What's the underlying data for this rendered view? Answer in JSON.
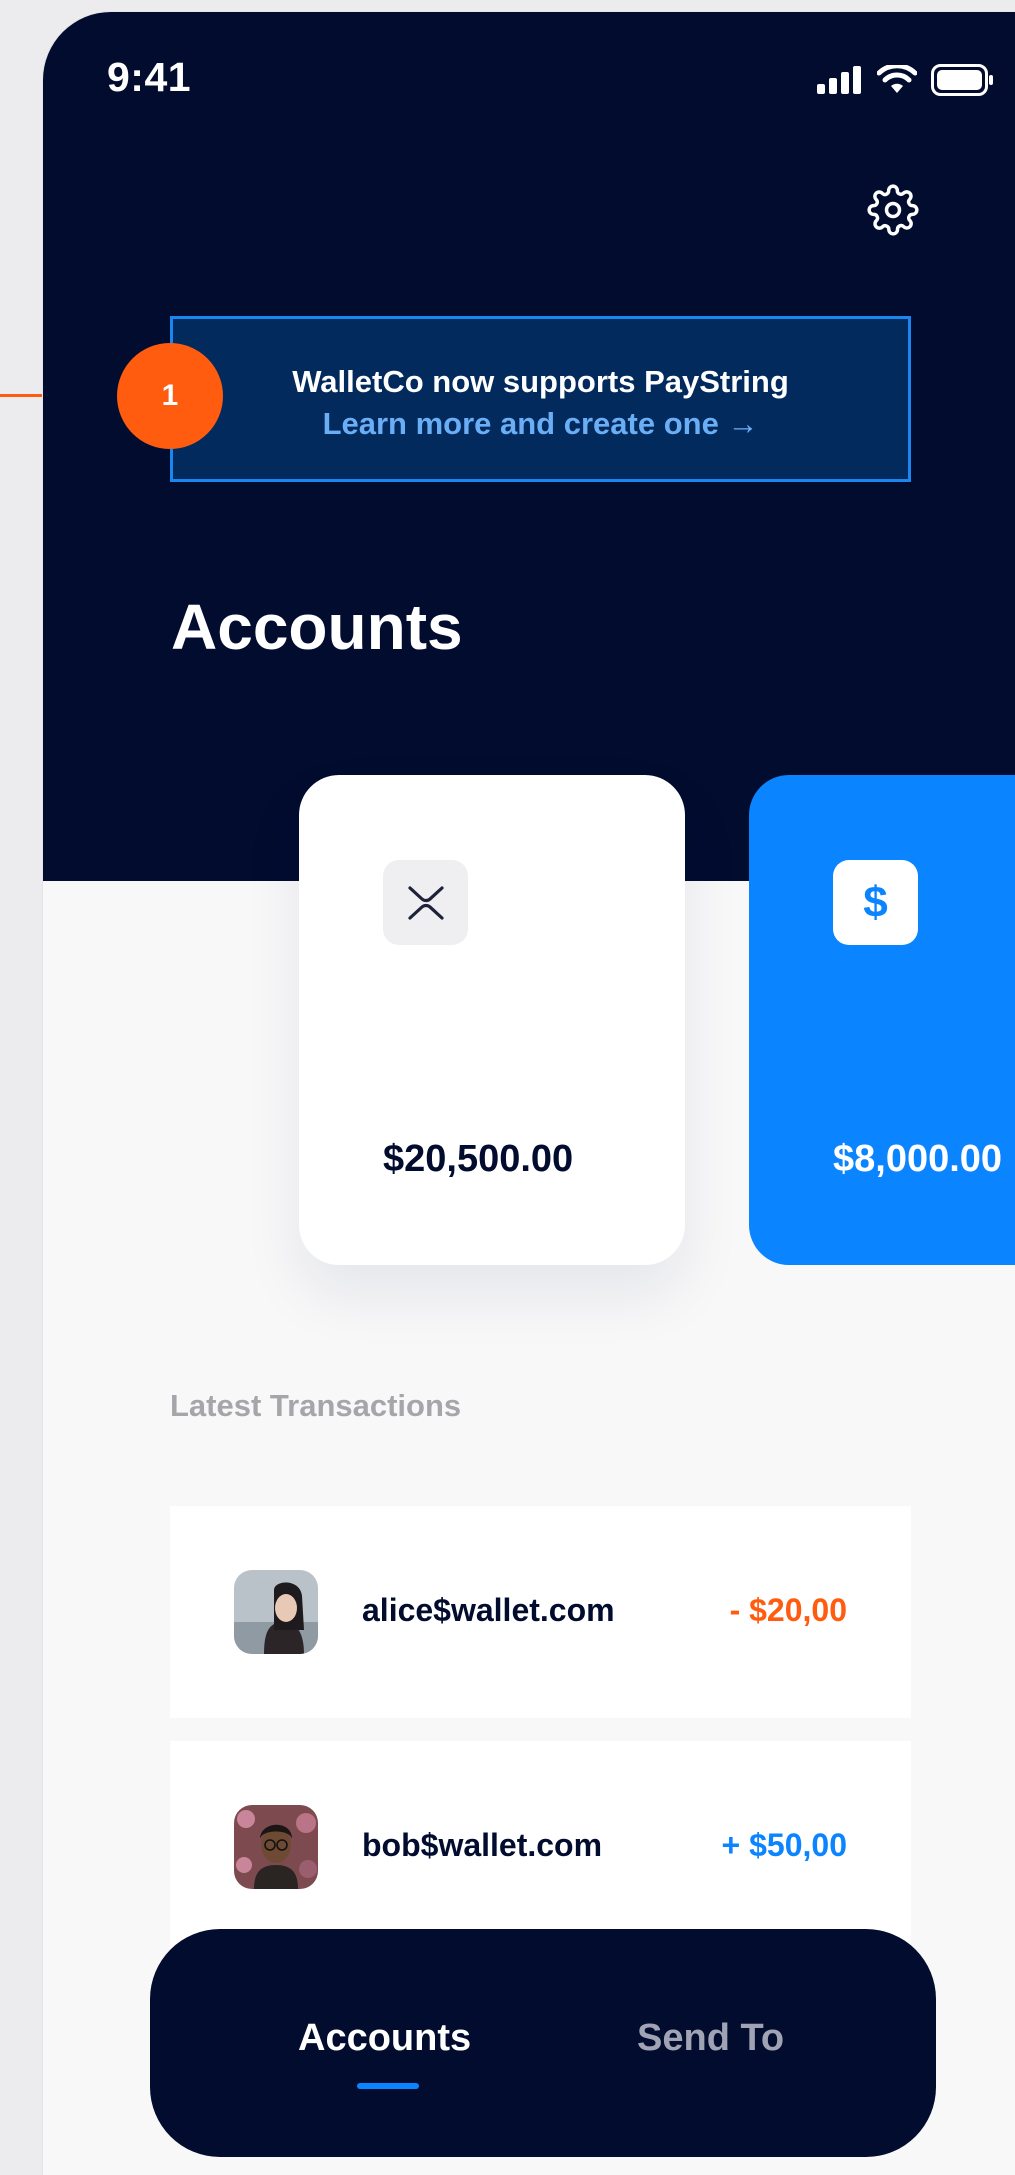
{
  "status_bar": {
    "time": "9:41",
    "icons": [
      "cellular-signal-icon",
      "wifi-icon",
      "battery-icon"
    ]
  },
  "header": {
    "settings_icon": "gear-icon"
  },
  "banner": {
    "title": "WalletCo now supports PayString",
    "link": "Learn more and create one →",
    "callout_number": "1"
  },
  "accounts": {
    "title": "Accounts",
    "cards": [
      {
        "icon": "xrp-icon",
        "balance": "$20,500.00"
      },
      {
        "icon": "dollar-icon",
        "icon_glyph": "$",
        "balance": "$8,000.00"
      }
    ]
  },
  "transactions": {
    "heading": "Latest Transactions",
    "items": [
      {
        "name": "alice$wallet.com",
        "amount": "- $20,00",
        "direction": "out"
      },
      {
        "name": "bob$wallet.com",
        "amount": "+ $50,00",
        "direction": "in"
      }
    ]
  },
  "tabbar": {
    "tabs": [
      {
        "label": "Accounts",
        "active": true
      },
      {
        "label": "Send To",
        "active": false
      }
    ]
  },
  "colors": {
    "navy": "#020c2f",
    "accent_blue": "#0a84ff",
    "accent_orange": "#ff5c10",
    "banner_bg": "#032a5d",
    "banner_border": "#1a86f0",
    "link_blue": "#6aaef6"
  }
}
